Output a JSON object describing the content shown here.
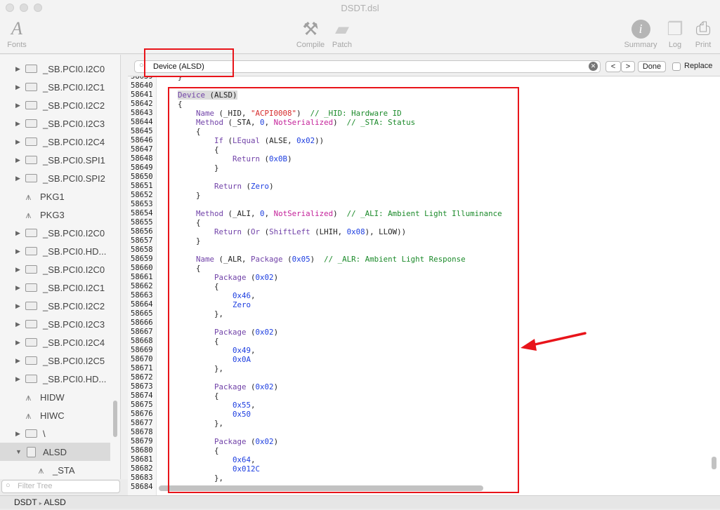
{
  "window": {
    "title": "DSDT.dsl"
  },
  "toolbar": {
    "fonts": "Fonts",
    "compile": "Compile",
    "patch": "Patch",
    "summary": "Summary",
    "log": "Log",
    "print": "Print"
  },
  "find": {
    "query": "Device (ALSD)",
    "prev": "<",
    "next": ">",
    "done": "Done",
    "replace": "Replace"
  },
  "sidebar": {
    "filter_placeholder": "Filter Tree",
    "items": [
      {
        "label": "_SB.PCI0.I2C0",
        "type": "folder"
      },
      {
        "label": "_SB.PCI0.I2C1",
        "type": "folder"
      },
      {
        "label": "_SB.PCI0.I2C2",
        "type": "folder"
      },
      {
        "label": "_SB.PCI0.I2C3",
        "type": "folder"
      },
      {
        "label": "_SB.PCI0.I2C4",
        "type": "folder"
      },
      {
        "label": "_SB.PCI0.SPI1",
        "type": "folder"
      },
      {
        "label": "_SB.PCI0.SPI2",
        "type": "folder"
      },
      {
        "label": "PKG1",
        "type": "method"
      },
      {
        "label": "PKG3",
        "type": "method"
      },
      {
        "label": "_SB.PCI0.I2C0",
        "type": "folder"
      },
      {
        "label": "_SB.PCI0.HD...",
        "type": "folder"
      },
      {
        "label": "_SB.PCI0.I2C0",
        "type": "folder"
      },
      {
        "label": "_SB.PCI0.I2C1",
        "type": "folder"
      },
      {
        "label": "_SB.PCI0.I2C2",
        "type": "folder"
      },
      {
        "label": "_SB.PCI0.I2C3",
        "type": "folder"
      },
      {
        "label": "_SB.PCI0.I2C4",
        "type": "folder"
      },
      {
        "label": "_SB.PCI0.I2C5",
        "type": "folder"
      },
      {
        "label": "_SB.PCI0.HD...",
        "type": "folder"
      },
      {
        "label": "HIDW",
        "type": "method"
      },
      {
        "label": "HIWC",
        "type": "method"
      },
      {
        "label": "\\",
        "type": "folder"
      },
      {
        "label": "ALSD",
        "type": "device",
        "expanded": true,
        "selected": true
      },
      {
        "label": "_STA",
        "type": "method",
        "child": true
      }
    ]
  },
  "editor": {
    "first_line": 58639,
    "lines": [
      [
        [
          "p",
          "    }"
        ]
      ],
      [],
      [
        [
          "p",
          "    "
        ],
        [
          "k",
          "Device",
          "hl"
        ],
        [
          "p",
          " (ALSD)",
          "hl"
        ]
      ],
      [
        [
          "p",
          "    {"
        ]
      ],
      [
        [
          "p",
          "        "
        ],
        [
          "k",
          "Name"
        ],
        [
          "p",
          " (_HID, "
        ],
        [
          "s",
          "\"ACPI0008\""
        ],
        [
          "p",
          ")  "
        ],
        [
          "c",
          "// _HID: Hardware ID"
        ]
      ],
      [
        [
          "p",
          "        "
        ],
        [
          "k",
          "Method"
        ],
        [
          "p",
          " (_STA, "
        ],
        [
          "n",
          "0"
        ],
        [
          "p",
          ", "
        ],
        [
          "m",
          "NotSerialized"
        ],
        [
          "p",
          ")  "
        ],
        [
          "c",
          "// _STA: Status"
        ]
      ],
      [
        [
          "p",
          "        {"
        ]
      ],
      [
        [
          "p",
          "            "
        ],
        [
          "k",
          "If"
        ],
        [
          "p",
          " ("
        ],
        [
          "k",
          "LEqual"
        ],
        [
          "p",
          " (ALSE, "
        ],
        [
          "n",
          "0x02"
        ],
        [
          "p",
          "))"
        ]
      ],
      [
        [
          "p",
          "            {"
        ]
      ],
      [
        [
          "p",
          "                "
        ],
        [
          "k",
          "Return"
        ],
        [
          "p",
          " ("
        ],
        [
          "n",
          "0x0B"
        ],
        [
          "p",
          ")"
        ]
      ],
      [
        [
          "p",
          "            }"
        ]
      ],
      [],
      [
        [
          "p",
          "            "
        ],
        [
          "k",
          "Return"
        ],
        [
          "p",
          " ("
        ],
        [
          "n",
          "Zero"
        ],
        [
          "p",
          ")"
        ]
      ],
      [
        [
          "p",
          "        }"
        ]
      ],
      [],
      [
        [
          "p",
          "        "
        ],
        [
          "k",
          "Method"
        ],
        [
          "p",
          " (_ALI, "
        ],
        [
          "n",
          "0"
        ],
        [
          "p",
          ", "
        ],
        [
          "m",
          "NotSerialized"
        ],
        [
          "p",
          ")  "
        ],
        [
          "c",
          "// _ALI: Ambient Light Illuminance"
        ]
      ],
      [
        [
          "p",
          "        {"
        ]
      ],
      [
        [
          "p",
          "            "
        ],
        [
          "k",
          "Return"
        ],
        [
          "p",
          " ("
        ],
        [
          "k",
          "Or"
        ],
        [
          "p",
          " ("
        ],
        [
          "k",
          "ShiftLeft"
        ],
        [
          "p",
          " (LHIH, "
        ],
        [
          "n",
          "0x08"
        ],
        [
          "p",
          "), LLOW))"
        ]
      ],
      [
        [
          "p",
          "        }"
        ]
      ],
      [],
      [
        [
          "p",
          "        "
        ],
        [
          "k",
          "Name"
        ],
        [
          "p",
          " (_ALR, "
        ],
        [
          "k",
          "Package"
        ],
        [
          "p",
          " ("
        ],
        [
          "n",
          "0x05"
        ],
        [
          "p",
          ")  "
        ],
        [
          "c",
          "// _ALR: Ambient Light Response"
        ]
      ],
      [
        [
          "p",
          "        {"
        ]
      ],
      [
        [
          "p",
          "            "
        ],
        [
          "k",
          "Package"
        ],
        [
          "p",
          " ("
        ],
        [
          "n",
          "0x02"
        ],
        [
          "p",
          ")"
        ]
      ],
      [
        [
          "p",
          "            {"
        ]
      ],
      [
        [
          "p",
          "                "
        ],
        [
          "n",
          "0x46"
        ],
        [
          "p",
          ","
        ]
      ],
      [
        [
          "p",
          "                "
        ],
        [
          "n",
          "Zero"
        ]
      ],
      [
        [
          "p",
          "            },"
        ]
      ],
      [],
      [
        [
          "p",
          "            "
        ],
        [
          "k",
          "Package"
        ],
        [
          "p",
          " ("
        ],
        [
          "n",
          "0x02"
        ],
        [
          "p",
          ")"
        ]
      ],
      [
        [
          "p",
          "            {"
        ]
      ],
      [
        [
          "p",
          "                "
        ],
        [
          "n",
          "0x49"
        ],
        [
          "p",
          ","
        ]
      ],
      [
        [
          "p",
          "                "
        ],
        [
          "n",
          "0x0A"
        ]
      ],
      [
        [
          "p",
          "            },"
        ]
      ],
      [],
      [
        [
          "p",
          "            "
        ],
        [
          "k",
          "Package"
        ],
        [
          "p",
          " ("
        ],
        [
          "n",
          "0x02"
        ],
        [
          "p",
          ")"
        ]
      ],
      [
        [
          "p",
          "            {"
        ]
      ],
      [
        [
          "p",
          "                "
        ],
        [
          "n",
          "0x55"
        ],
        [
          "p",
          ","
        ]
      ],
      [
        [
          "p",
          "                "
        ],
        [
          "n",
          "0x50"
        ]
      ],
      [
        [
          "p",
          "            },"
        ]
      ],
      [],
      [
        [
          "p",
          "            "
        ],
        [
          "k",
          "Package"
        ],
        [
          "p",
          " ("
        ],
        [
          "n",
          "0x02"
        ],
        [
          "p",
          ")"
        ]
      ],
      [
        [
          "p",
          "            {"
        ]
      ],
      [
        [
          "p",
          "                "
        ],
        [
          "n",
          "0x64"
        ],
        [
          "p",
          ","
        ]
      ],
      [
        [
          "p",
          "                "
        ],
        [
          "n",
          "0x012C"
        ]
      ],
      [
        [
          "p",
          "            },"
        ]
      ],
      []
    ]
  },
  "statusbar": {
    "path": [
      "DSDT",
      "ALSD"
    ],
    "separator": "▸"
  },
  "annotation_color": "#e8141a"
}
